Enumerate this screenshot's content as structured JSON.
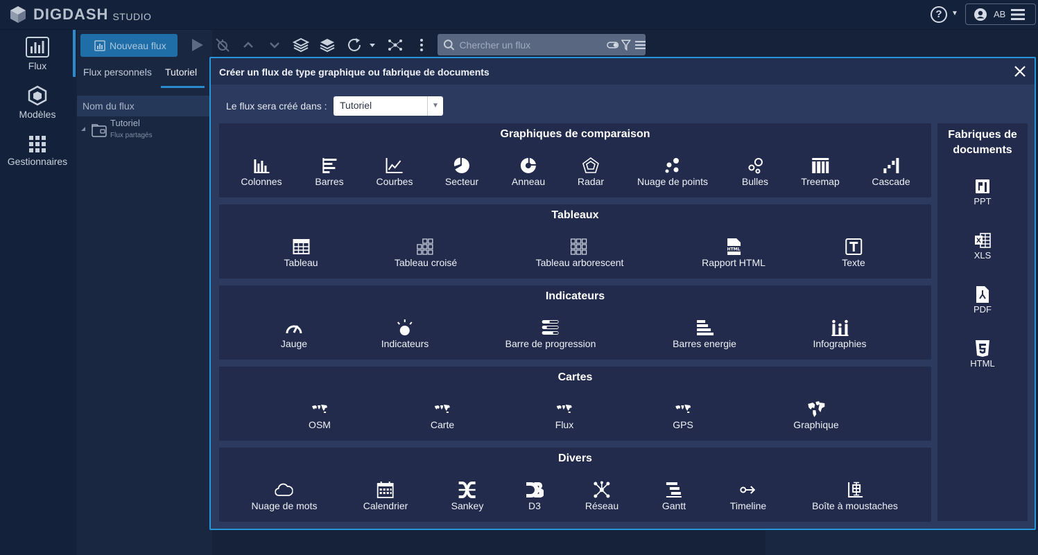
{
  "app": {
    "brand": "DIGDASH",
    "product": "STUDIO",
    "help_label": "?",
    "user_initials": "AB"
  },
  "sidebar": {
    "items": [
      {
        "label": "Flux",
        "icon": "bar-chart-icon"
      },
      {
        "label": "Modèles",
        "icon": "cube-icon"
      },
      {
        "label": "Gestionnaires",
        "icon": "grid-icon"
      }
    ]
  },
  "toolbar": {
    "new_flux_label": "Nouveau flux",
    "search_placeholder": "Chercher un flux"
  },
  "tabs": [
    "Flux personnels",
    "Tutoriel"
  ],
  "flux_list": {
    "column_header": "Nom du flux",
    "items": [
      {
        "title": "Tutoriel",
        "subtitle": "Flux partagés"
      }
    ]
  },
  "modal": {
    "title": "Créer un flux de type graphique ou fabrique de documents",
    "destination_label": "Le flux sera créé dans :",
    "destination_value": "Tutoriel",
    "sections": [
      {
        "title": "Graphiques de comparaison",
        "items": [
          {
            "label": "Colonnes",
            "icon": "columns-icon"
          },
          {
            "label": "Barres",
            "icon": "bars-icon"
          },
          {
            "label": "Courbes",
            "icon": "line-chart-icon"
          },
          {
            "label": "Secteur",
            "icon": "pie-icon"
          },
          {
            "label": "Anneau",
            "icon": "donut-icon"
          },
          {
            "label": "Radar",
            "icon": "radar-icon"
          },
          {
            "label": "Nuage de points",
            "icon": "scatter-icon"
          },
          {
            "label": "Bulles",
            "icon": "bubbles-icon"
          },
          {
            "label": "Treemap",
            "icon": "treemap-icon"
          },
          {
            "label": "Cascade",
            "icon": "waterfall-icon"
          }
        ]
      },
      {
        "title": "Tableaux",
        "items": [
          {
            "label": "Tableau",
            "icon": "table-icon"
          },
          {
            "label": "Tableau croisé",
            "icon": "pivot-table-icon"
          },
          {
            "label": "Tableau arborescent",
            "icon": "tree-table-icon"
          },
          {
            "label": "Rapport HTML",
            "icon": "html-report-icon"
          },
          {
            "label": "Texte",
            "icon": "text-icon"
          }
        ]
      },
      {
        "title": "Indicateurs",
        "items": [
          {
            "label": "Jauge",
            "icon": "gauge-icon"
          },
          {
            "label": "Indicateurs",
            "icon": "indicator-icon"
          },
          {
            "label": "Barre de progression",
            "icon": "progress-bar-icon"
          },
          {
            "label": "Barres energie",
            "icon": "energy-bars-icon"
          },
          {
            "label": "Infographies",
            "icon": "infographic-icon"
          }
        ]
      },
      {
        "title": "Cartes",
        "items": [
          {
            "label": "OSM",
            "icon": "world-map-icon"
          },
          {
            "label": "Carte",
            "icon": "world-map-icon"
          },
          {
            "label": "Flux",
            "icon": "world-map-icon"
          },
          {
            "label": "GPS",
            "icon": "world-map-icon"
          },
          {
            "label": "Graphique",
            "icon": "world-map-large-icon"
          }
        ]
      },
      {
        "title": "Divers",
        "items": [
          {
            "label": "Nuage de mots",
            "icon": "cloud-icon"
          },
          {
            "label": "Calendrier",
            "icon": "calendar-icon"
          },
          {
            "label": "Sankey",
            "icon": "sankey-icon"
          },
          {
            "label": "D3",
            "icon": "d3-icon"
          },
          {
            "label": "Réseau",
            "icon": "network-icon"
          },
          {
            "label": "Gantt",
            "icon": "gantt-icon"
          },
          {
            "label": "Timeline",
            "icon": "timeline-icon"
          },
          {
            "label": "Boîte à moustaches",
            "icon": "boxplot-icon"
          }
        ]
      }
    ],
    "factories": {
      "title_line1": "Fabriques de",
      "title_line2": "documents",
      "items": [
        {
          "label": "PPT",
          "icon": "ppt-file-icon"
        },
        {
          "label": "XLS",
          "icon": "xls-file-icon"
        },
        {
          "label": "PDF",
          "icon": "pdf-file-icon"
        },
        {
          "label": "HTML",
          "icon": "html5-icon"
        }
      ]
    }
  }
}
